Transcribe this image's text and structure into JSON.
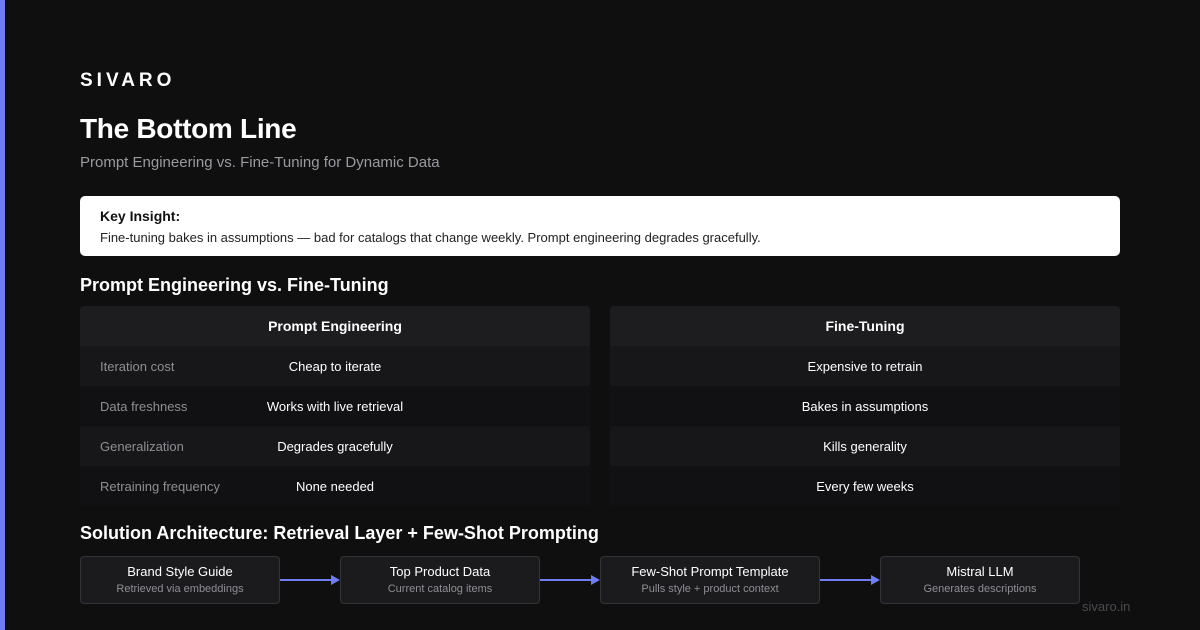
{
  "brand": "SIVARO",
  "title": "The Bottom Line",
  "subtitle": "Prompt Engineering vs. Fine-Tuning for Dynamic Data",
  "insight": {
    "label": "Key Insight:",
    "text": "Fine-tuning bakes in assumptions — bad for catalogs that change weekly. Prompt engineering degrades gracefully."
  },
  "comparison": {
    "section_title": "Prompt Engineering vs. Fine-Tuning",
    "left_header": "Prompt Engineering",
    "right_header": "Fine-Tuning",
    "rows": [
      {
        "label": "Iteration cost",
        "prompt": "Cheap to iterate",
        "finetune": "Expensive to retrain"
      },
      {
        "label": "Data freshness",
        "prompt": "Works with live retrieval",
        "finetune": "Bakes in assumptions"
      },
      {
        "label": "Generalization",
        "prompt": "Degrades gracefully",
        "finetune": "Kills generality"
      },
      {
        "label": "Retraining frequency",
        "prompt": "None needed",
        "finetune": "Every few weeks"
      }
    ]
  },
  "architecture": {
    "section_title": "Solution Architecture: Retrieval Layer + Few-Shot Prompting",
    "steps": [
      {
        "title": "Brand Style Guide",
        "sub": "Retrieved via embeddings"
      },
      {
        "title": "Top Product Data",
        "sub": "Current catalog items"
      },
      {
        "title": "Few-Shot Prompt Template",
        "sub": "Pulls style + product context"
      },
      {
        "title": "Mistral LLM",
        "sub": "Generates descriptions"
      }
    ]
  },
  "footer": "sivaro.in",
  "colors": {
    "accent": "#6f7cf2",
    "background": "#0f0f10"
  }
}
